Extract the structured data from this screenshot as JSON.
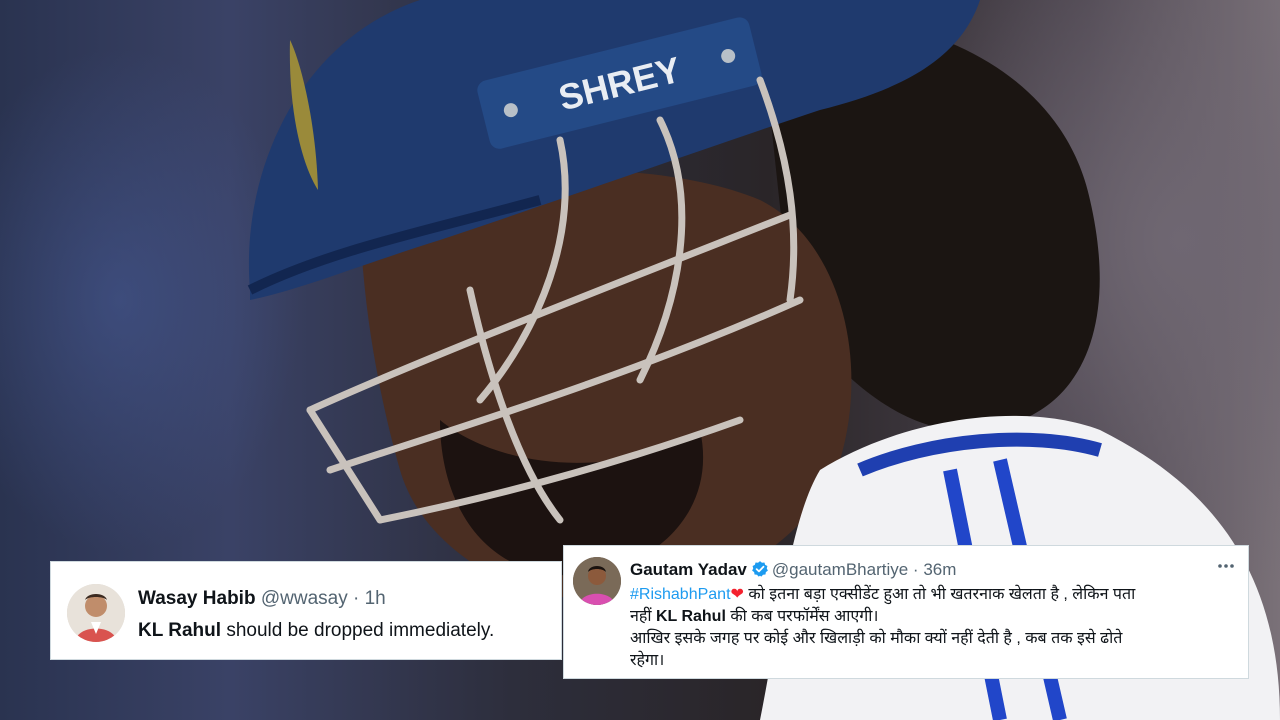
{
  "photo": {
    "helmet_brand": "SHREY"
  },
  "tweets": {
    "left": {
      "name": "Wasay Habib",
      "handle": "@wwasay",
      "dot": "·",
      "time": "1h",
      "body_bold": "KL Rahul",
      "body_rest": " should be dropped immediately."
    },
    "right": {
      "name": "Gautam Yadav",
      "handle": "@gautamBhartiye",
      "dot": "·",
      "time": "36m",
      "hashtag": "#RishabhPant",
      "heart": "❤",
      "line1_rest": " को इतना बड़ा एक्सीडेंट हुआ तो भी खतरनाक खेलता है , लेकिन पता",
      "line2_pre": "नहीं ",
      "line2_bold": "KL Rahul",
      "line2_rest": " की कब परफॉर्मेंस आएगी।",
      "line3": "आखिर इसके जगह पर कोई और खिलाड़ी को मौका क्यों नहीं देती है , कब तक इसे ढोते",
      "line4": "रहेगा।"
    }
  },
  "colors": {
    "link": "#1d9bf0",
    "verified": "#1d9bf0",
    "heart": "#f4212e",
    "helmet": "#1f3a6e"
  },
  "icons": [
    "verified-badge-icon",
    "more-options-icon",
    "heart-emoji"
  ]
}
